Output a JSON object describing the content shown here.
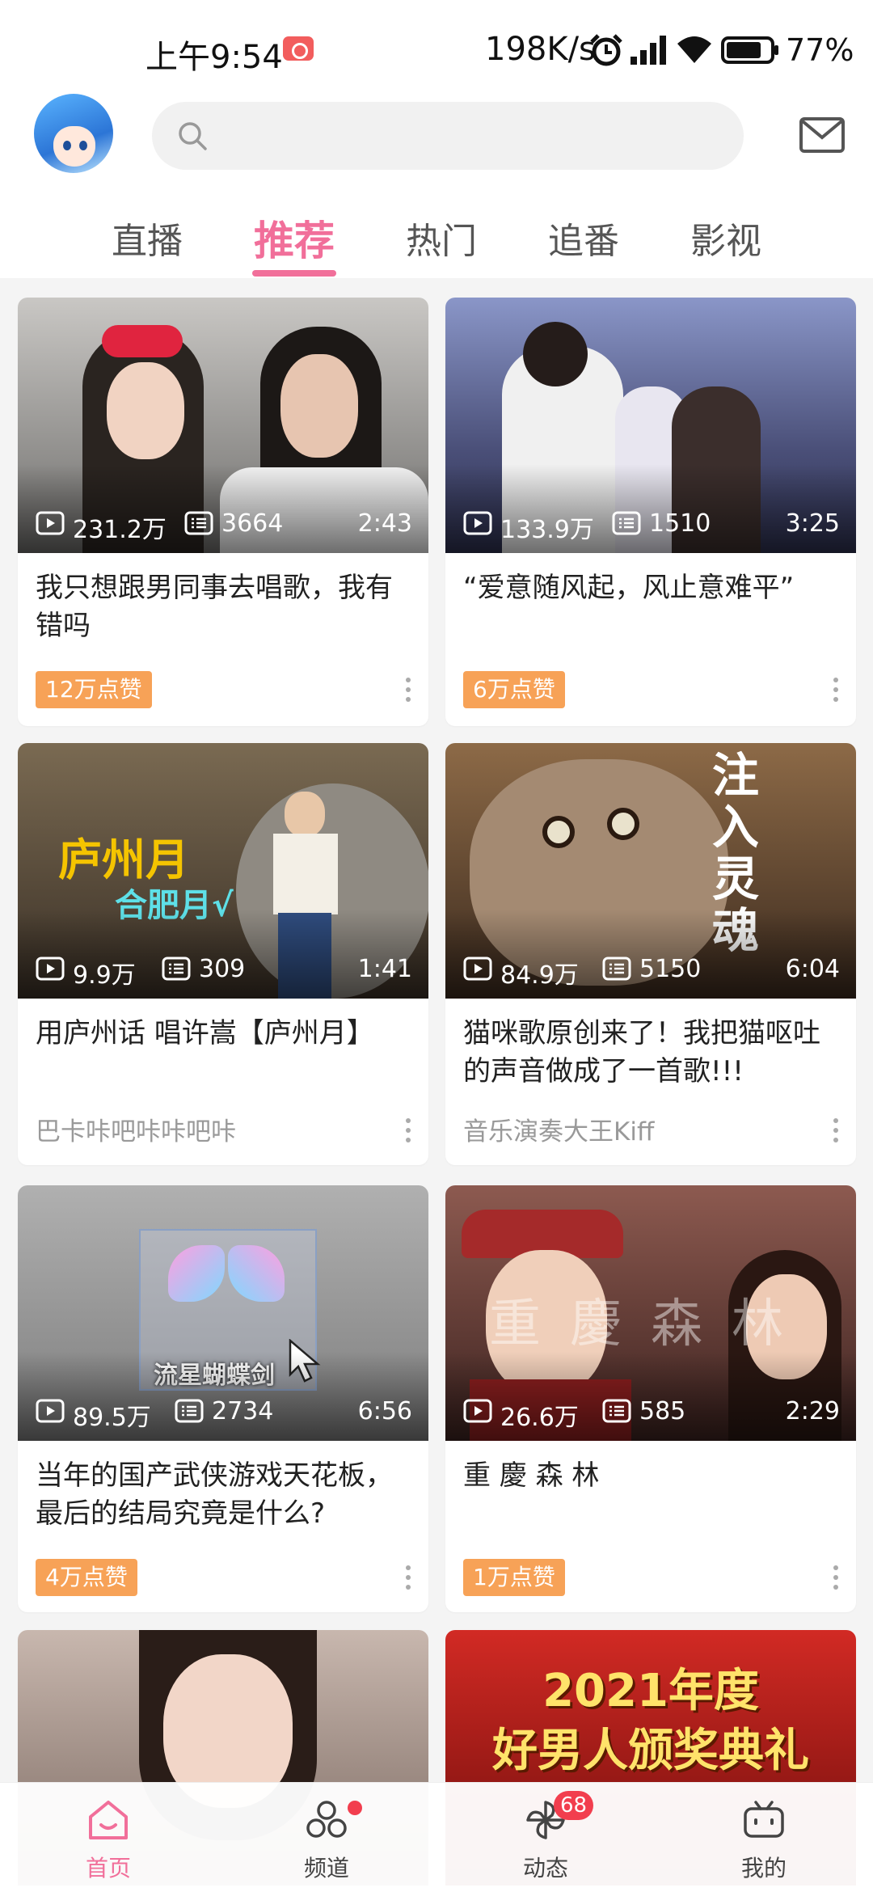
{
  "status_bar": {
    "time": "上午9:54",
    "net_speed": "198K/s",
    "battery_text": "77%"
  },
  "header": {
    "search_placeholder": "",
    "tabs": [
      "直播",
      "推荐",
      "热门",
      "追番",
      "影视"
    ],
    "active_tab": "推荐"
  },
  "colors": {
    "accent": "#f16f9a",
    "likes_badge": "#f7a257",
    "badge_red": "#f23e4e"
  },
  "feed": [
    {
      "views": "231.2万",
      "danmaku": "3664",
      "duration": "2:43",
      "title": "我只想跟男同事去唱歌，我有错吗",
      "footer_type": "likes",
      "footer": "12万点赞",
      "thumb_colors": [
        "#b9b7b4",
        "#6e6d6b"
      ]
    },
    {
      "views": "133.9万",
      "danmaku": "1510",
      "duration": "3:25",
      "title": "“爱意随风起，风止意难平”",
      "footer_type": "likes",
      "footer": "6万点赞",
      "thumb_colors": [
        "#7a85b8",
        "#3a3f66"
      ]
    },
    {
      "views": "9.9万",
      "danmaku": "309",
      "duration": "1:41",
      "title": "用庐州话 唱许嵩【庐州月】",
      "footer_type": "author",
      "footer": "巴卡咔吧咔咔吧咔",
      "thumb_colors": [
        "#6a5a44",
        "#3a3026"
      ]
    },
    {
      "views": "84.9万",
      "danmaku": "5150",
      "duration": "6:04",
      "title": "猫咪歌原创来了！我把猫呕吐的声音做成了一首歌!!!",
      "footer_type": "author",
      "footer": "音乐演奏大王Kiff",
      "thumb_colors": [
        "#7b5a3d",
        "#3b2a1e"
      ]
    },
    {
      "views": "89.5万",
      "danmaku": "2734",
      "duration": "6:56",
      "title": "当年的国产武侠游戏天花板，最后的结局究竟是什么?",
      "footer_type": "likes",
      "footer": "4万点赞",
      "thumb_colors": [
        "#a9a9a9",
        "#7d7d7d"
      ]
    },
    {
      "views": "26.6万",
      "danmaku": "585",
      "duration": "2:29",
      "title": "重 慶 森 林",
      "footer_type": "likes",
      "footer": "1万点赞",
      "thumb_colors": [
        "#7e4a42",
        "#3d2320"
      ]
    },
    {
      "views": "",
      "danmaku": "",
      "duration": "",
      "title": "",
      "footer_type": "none",
      "footer": "",
      "thumb_colors": [
        "#b8a69c",
        "#7c6a62"
      ]
    },
    {
      "views": "",
      "danmaku": "",
      "duration": "",
      "title": "",
      "footer_type": "none",
      "footer": "",
      "thumb_text_1": "2021年度",
      "thumb_text_2": "好男人颁奖典礼",
      "thumb_colors": [
        "#c8201c",
        "#6e0d0b"
      ]
    }
  ],
  "bottom_nav": [
    {
      "label": "首页",
      "icon": "home-icon",
      "active": true
    },
    {
      "label": "频道",
      "icon": "channels-icon",
      "dot": true
    },
    {
      "label": "动态",
      "icon": "pinwheel-icon",
      "badge": "68"
    },
    {
      "label": "我的",
      "icon": "tv-icon"
    }
  ]
}
